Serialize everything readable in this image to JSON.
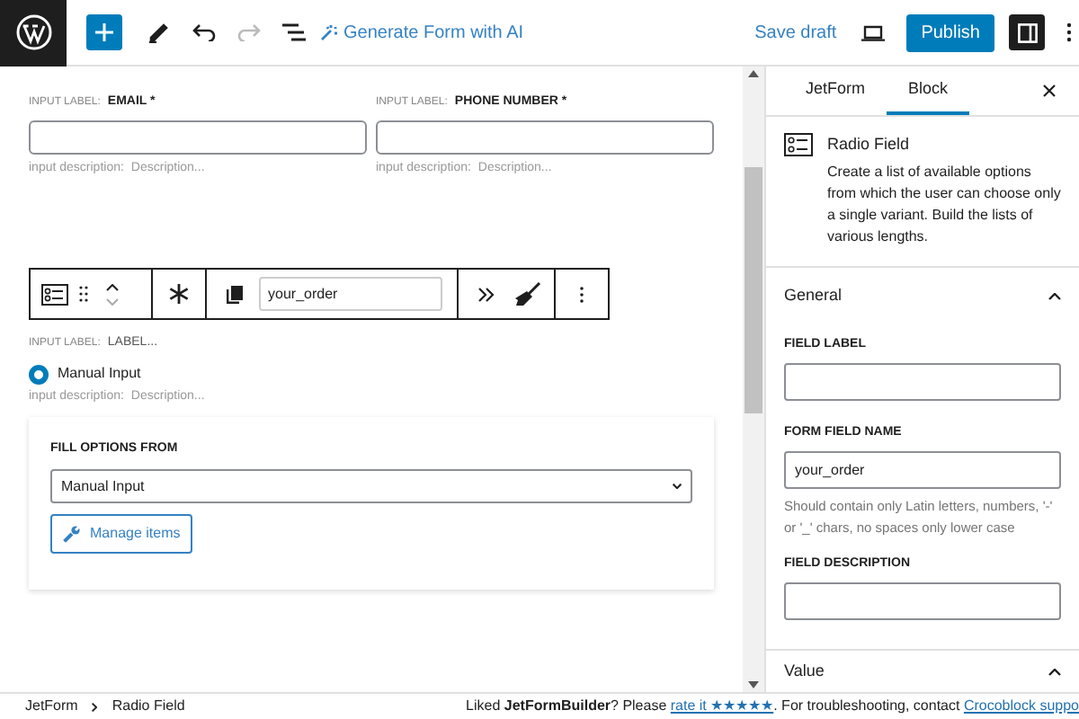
{
  "topbar": {
    "generate": "Generate Form with AI",
    "save_draft": "Save draft",
    "publish": "Publish"
  },
  "fields": [
    {
      "label_prefix": "INPUT LABEL:",
      "label": "EMAIL *",
      "description_prefix": "input description:",
      "description": "Description..."
    },
    {
      "label_prefix": "INPUT LABEL:",
      "label": "PHONE NUMBER *",
      "description_prefix": "input description:",
      "description": "Description..."
    }
  ],
  "block_toolbar": {
    "name_value": "your_order"
  },
  "radio_field": {
    "label_prefix": "INPUT LABEL:",
    "label": "LABEL...",
    "options": [
      {
        "label": "Manual Input",
        "selected": true
      }
    ],
    "description_prefix": "input description:",
    "description": "Description..."
  },
  "options_panel": {
    "label": "FILL OPTIONS FROM",
    "value": "Manual Input",
    "button": "Manage items"
  },
  "breadcrumb": [
    "JetForm",
    "Radio Field"
  ],
  "notice": [
    {
      "kind": "text",
      "text": "Liked **JetFormBuilder**? Please "
    },
    {
      "kind": "link",
      "text": "rate it ★★★★★"
    },
    {
      "kind": "text",
      "text": ". For troubleshooting, contact "
    },
    {
      "kind": "link",
      "text": "Crocoblock suppo"
    }
  ],
  "sidebar": {
    "tabs": [
      {
        "label": "JetForm",
        "selected": false
      },
      {
        "label": "Block",
        "selected": true
      }
    ],
    "block": {
      "title": "Radio Field",
      "description": "Create a list of available options from which the user can choose only a single variant. Build the lists of various lengths."
    },
    "panels": [
      {
        "title": "General",
        "expanded": true,
        "fields": [
          {
            "label": "FIELD LABEL"
          },
          {
            "label": "FORM FIELD NAME",
            "value": "your_order",
            "help": "Should contain only Latin letters, numbers, '-' or '_' chars, no spaces only lower case"
          },
          {
            "label": "FIELD DESCRIPTION"
          }
        ]
      },
      {
        "title": "Value",
        "expanded": true
      }
    ]
  }
}
